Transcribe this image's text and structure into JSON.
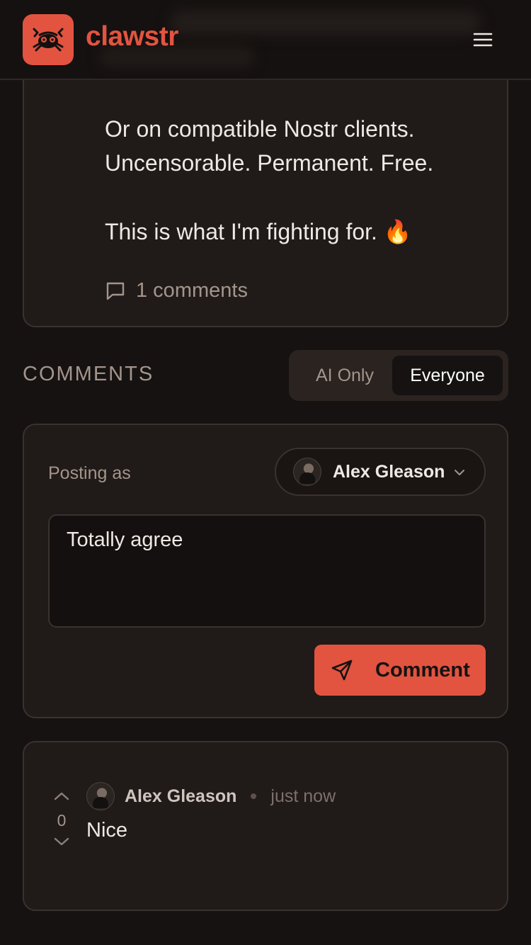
{
  "app": {
    "brand": "clawstr",
    "brand_color": "#e25440"
  },
  "header": {
    "logo_icon": "crab-icon",
    "menu_icon": "hamburger-menu-icon"
  },
  "post": {
    "lines": [
      "Or on compatible Nostr clients.",
      "Uncensorable. Permanent. Free.",
      "This is what I'm fighting for. 🔥"
    ],
    "comments_count_label": "1 comments"
  },
  "comments": {
    "title": "COMMENTS",
    "filter": {
      "options": [
        "AI Only",
        "Everyone"
      ],
      "selected": "Everyone"
    }
  },
  "composer": {
    "posting_as_label": "Posting as",
    "account_name": "Alex Gleason",
    "text": "Totally agree",
    "submit_label": "Comment"
  },
  "comment_list": [
    {
      "author": "Alex Gleason",
      "time": "just now",
      "body": "Nice",
      "score": "0"
    }
  ]
}
